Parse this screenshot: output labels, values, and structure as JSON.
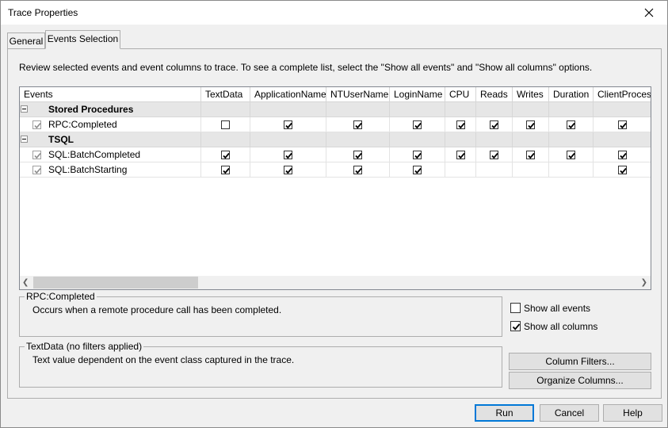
{
  "window": {
    "title": "Trace Properties"
  },
  "tabs": [
    {
      "label": "General",
      "active": false
    },
    {
      "label": "Events Selection",
      "active": true
    }
  ],
  "instructions": "Review selected events and event columns to trace. To see a complete list, select the \"Show all events\" and \"Show all columns\" options.",
  "grid": {
    "columns": [
      "Events",
      "TextData",
      "ApplicationName",
      "NTUserName",
      "LoginName",
      "CPU",
      "Reads",
      "Writes",
      "Duration",
      "ClientProcessI"
    ],
    "groups": [
      {
        "name": "Stored Procedures",
        "events": [
          {
            "name": "RPC:Completed",
            "checks": [
              false,
              true,
              true,
              true,
              true,
              true,
              true,
              true,
              true
            ]
          }
        ]
      },
      {
        "name": "TSQL",
        "events": [
          {
            "name": "SQL:BatchCompleted",
            "checks": [
              true,
              true,
              true,
              true,
              true,
              true,
              true,
              true,
              true
            ]
          },
          {
            "name": "SQL:BatchStarting",
            "checks": [
              true,
              true,
              true,
              true,
              null,
              null,
              null,
              null,
              true
            ]
          }
        ]
      }
    ]
  },
  "event_description": {
    "title": "RPC:Completed",
    "text": "Occurs when a remote procedure call has been completed."
  },
  "column_description": {
    "title": "TextData (no filters applied)",
    "text": "Text value dependent on the event class captured in the trace."
  },
  "options": {
    "show_all_events": {
      "label": "Show all events",
      "checked": false
    },
    "show_all_columns": {
      "label": "Show all columns",
      "checked": true
    }
  },
  "buttons": {
    "column_filters": "Column Filters...",
    "organize_columns": "Organize Columns...",
    "run": "Run",
    "cancel": "Cancel",
    "help": "Help"
  }
}
